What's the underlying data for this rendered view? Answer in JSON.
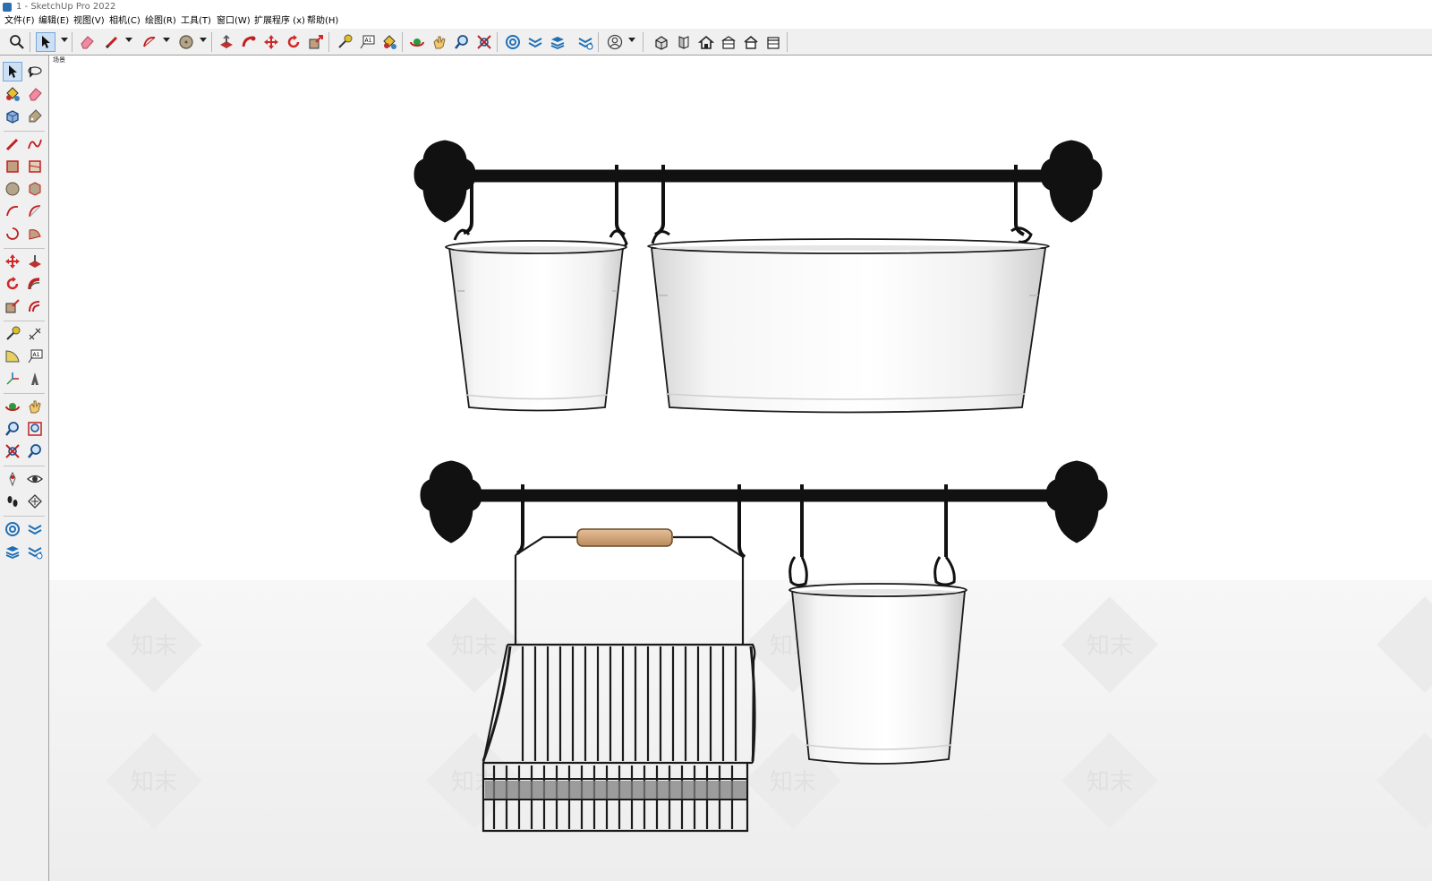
{
  "window": {
    "title": "1 - SketchUp Pro 2022"
  },
  "menu": [
    "文件(F)",
    "编辑(E)",
    "视图(V)",
    "相机(C)",
    "绘图(R)",
    "工具(T)",
    "窗口(W)",
    "扩展程序 (x)",
    "帮助(H)"
  ],
  "viewport": {
    "scene_tab": "场景"
  },
  "watermark": "知末",
  "toolbar_icons": [
    "zoom-icon",
    "select-icon",
    "eraser-icon",
    "pencil-icon",
    "arc-icon",
    "circle-icon",
    "push-pull-icon",
    "follow-me-icon",
    "move-icon",
    "rotate-icon",
    "scale-icon",
    "tape-measure-icon",
    "text-icon",
    "paint-bucket-icon",
    "orbit-icon",
    "pan-icon",
    "zoom-window-icon",
    "zoom-extents-icon",
    "warehouse-icon",
    "extension-icon",
    "layers-icon",
    "sandbox-icon",
    "account-icon",
    "view-iso-icon",
    "view-front-icon",
    "view-top-icon",
    "view-right-icon",
    "view-back-icon",
    "view-left-icon"
  ],
  "colors": {
    "accent": "#1f6fb5",
    "tool_red": "#d0302a",
    "rack": "#111111",
    "handle_wood": "#d1a57a"
  }
}
